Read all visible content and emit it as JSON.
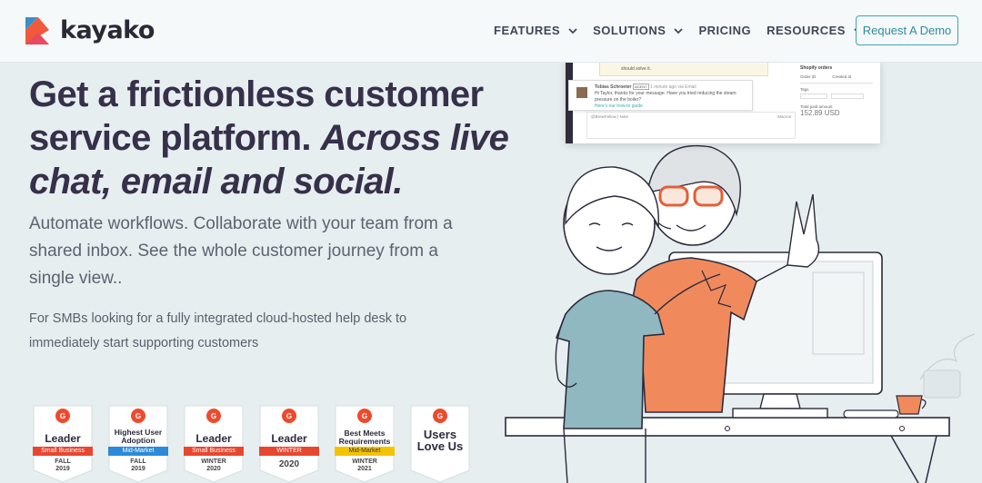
{
  "brand": {
    "name": "kayako",
    "accent": "#3ba8b5",
    "logo_colors": [
      "#f05a3a",
      "#3a8fc9",
      "#e84a5f"
    ]
  },
  "nav": {
    "items": [
      {
        "label": "FEATURES",
        "has_dropdown": true
      },
      {
        "label": "SOLUTIONS",
        "has_dropdown": true
      },
      {
        "label": "PRICING",
        "has_dropdown": false
      },
      {
        "label": "RESOURCES",
        "has_dropdown": true
      }
    ],
    "cta": "Request A Demo"
  },
  "hero": {
    "headline_plain": "Get a frictionless customer service platform.",
    "headline_italic_1": "Across",
    "headline_italic_2": "live chat, email and social.",
    "subhead": "Automate workflows. Collaborate with your team from a shared inbox. See the whole customer journey from a single view..",
    "audience": "For SMBs looking for a fully integrated cloud-hosted help desk to immediately start supporting customers"
  },
  "badges": [
    {
      "title": "Leader",
      "ribbon": "Small Business",
      "ribbon_color": "#e8472f",
      "season": [
        "FALL",
        "2019"
      ]
    },
    {
      "title": "Highest User Adoption",
      "ribbon": "Mid-Market",
      "ribbon_color": "#2c8ad8",
      "season": [
        "FALL",
        "2019"
      ]
    },
    {
      "title": "Leader",
      "ribbon": "Small Business",
      "ribbon_color": "#e8472f",
      "season": [
        "WINTER",
        "2020"
      ]
    },
    {
      "title": "Leader",
      "ribbon": "WINTER",
      "ribbon_color": "#e8472f",
      "season": [
        "2020"
      ]
    },
    {
      "title": "Best Meets Requirements",
      "ribbon": "Mid-Market",
      "ribbon_color": "#f4c300",
      "season": [
        "WINTER",
        "2021"
      ]
    },
    {
      "title": "Users Love Us",
      "ribbon": "",
      "ribbon_color": "",
      "season": []
    }
  ],
  "app_preview": {
    "top_message": "should solve it.",
    "author": "Tobias Schroeter",
    "author_tag": "AGENT",
    "author_meta": "1 minute ago via Email",
    "reply_body": "Hi Taylor, thanks for your message. Have you tried reducing the steam pressure on the boiler?",
    "reply_link": "Here's our how-to guide",
    "reply_to": "@BrewFellow",
    "reply_tab": "Note",
    "reply_assignee": "Macros",
    "panel_title": "Shopify orders",
    "panel_order_label": "Order ID",
    "panel_created_label": "Created at",
    "panel_tags_label": "Tags",
    "panel_total_label": "Total paid amount",
    "panel_total_value": "152.89 USD"
  }
}
